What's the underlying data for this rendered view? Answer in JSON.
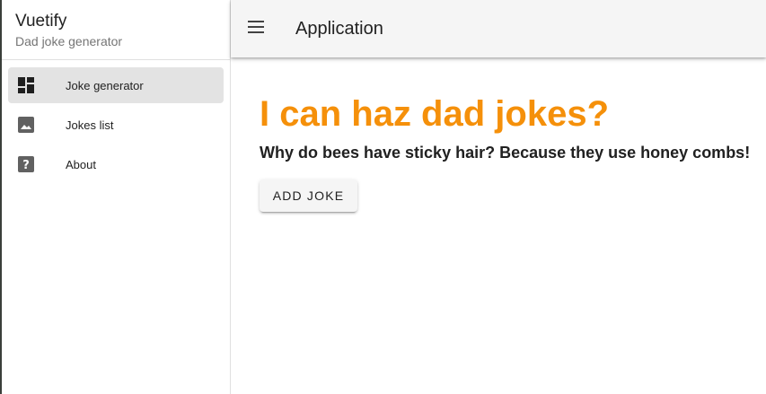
{
  "drawer": {
    "title": "Vuetify",
    "subtitle": "Dad joke generator",
    "items": [
      {
        "label": "Joke generator",
        "icon": "dashboard-icon",
        "active": true
      },
      {
        "label": "Jokes list",
        "icon": "image-icon",
        "active": false
      },
      {
        "label": "About",
        "icon": "help-box-icon",
        "active": false
      }
    ]
  },
  "appbar": {
    "menu_icon": "menu-icon",
    "title": "Application"
  },
  "main": {
    "headline": "I can haz dad jokes?",
    "joke": "Why do bees have sticky hair? Because they use honey combs!",
    "add_button_label": "ADD JOKE"
  },
  "colors": {
    "accent": "#f5900a",
    "appbar_bg": "#f5f5f5",
    "active_item_bg": "#e3e3e3",
    "icon": "#424242"
  }
}
